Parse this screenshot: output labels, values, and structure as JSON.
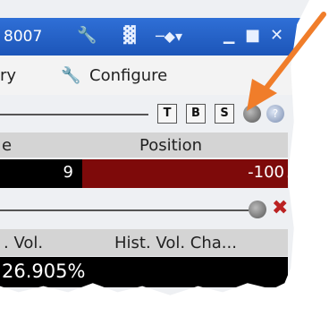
{
  "window": {
    "title": "8007"
  },
  "menubar": {
    "item_partial": "ry",
    "configure_label": "Configure"
  },
  "toolbar": {
    "t_label": "T",
    "b_label": "B",
    "s_label": "S"
  },
  "table": {
    "col_partial": "e",
    "position_header": "Position",
    "row_value_left": "9",
    "position_value": "-100",
    "position_color": "#7e0a0a"
  },
  "vol_table": {
    "col1_header": ". Vol.",
    "col2_header": "Hist. Vol. Cha...",
    "value": "26.905%"
  },
  "annotation": {
    "arrow_color": "#f07d2a"
  }
}
